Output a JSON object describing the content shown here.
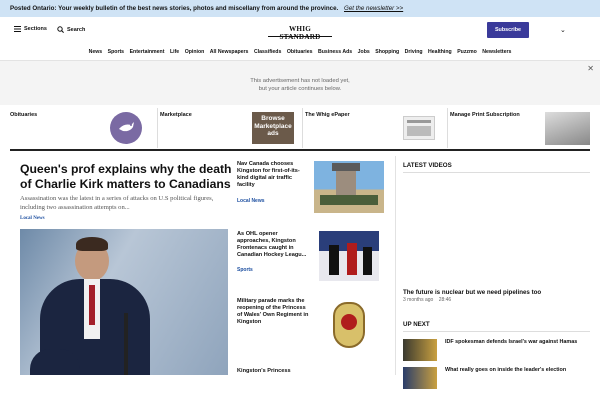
{
  "banner": {
    "prefix": "Posted Ontario:",
    "text": "Your weekly bulletin of the best news stories, photos and miscellany from around the province.",
    "link": "Get the newsletter >>"
  },
  "header": {
    "sections_label": "Sections",
    "search_label": "Search",
    "logo": "WHIG STANDARD",
    "subscribe_label": "Subscribe"
  },
  "nav": {
    "items": [
      "News",
      "Sports",
      "Entertainment",
      "Life",
      "Opinion",
      "All Newspapers",
      "Classifieds",
      "Obituaries",
      "Business Ads",
      "Jobs",
      "Shopping",
      "Driving",
      "Healthing",
      "Puzzmo",
      "Newsletters"
    ]
  },
  "ad": {
    "line1": "This advertisement has not loaded yet,",
    "line2": "but your article continues below."
  },
  "promo_strip": {
    "obituaries": "Obituaries",
    "marketplace": "Marketplace",
    "marketplace_ad": "Browse Marketplace ads",
    "epaper": "The Whig ePaper",
    "print_sub": "Manage Print Subscription"
  },
  "lead": {
    "title": "Queen's prof explains why the death of Charlie Kirk matters to Canadians",
    "summary": "Assassination was the latest in a series of attacks on U.S political figures, including two assassination attempts on...",
    "tag": "Local News"
  },
  "stories": [
    {
      "title": "Nav Canada chooses Kingston for first-of-its-kind digital air traffic facility",
      "tag": "Local News"
    },
    {
      "title": "As OHL opener approaches, Kingston Frontenacs caught in Canadian Hockey Leagu...",
      "tag": "Sports"
    },
    {
      "title": "Military parade marks the reopening of the Princess of Wales' Own Regiment in Kingston",
      "tag": ""
    },
    {
      "title": "Kingston's Princess",
      "tag": ""
    }
  ],
  "sidebar": {
    "latest_videos": "LATEST VIDEOS",
    "video_title": "The future is nuclear but we need pipelines too",
    "video_meta": "3 months ago",
    "video_duration": "28:46",
    "up_next": "UP NEXT",
    "up_next_items": [
      {
        "title": "IDF spokesman defends Israel's war against Hamas"
      },
      {
        "title": "What really goes on inside the leader's election"
      }
    ]
  },
  "colors": {
    "banner_bg": "#cfe3f5",
    "subscribe_bg": "#3a3a9a",
    "tag_blue": "#1d4fa0"
  }
}
